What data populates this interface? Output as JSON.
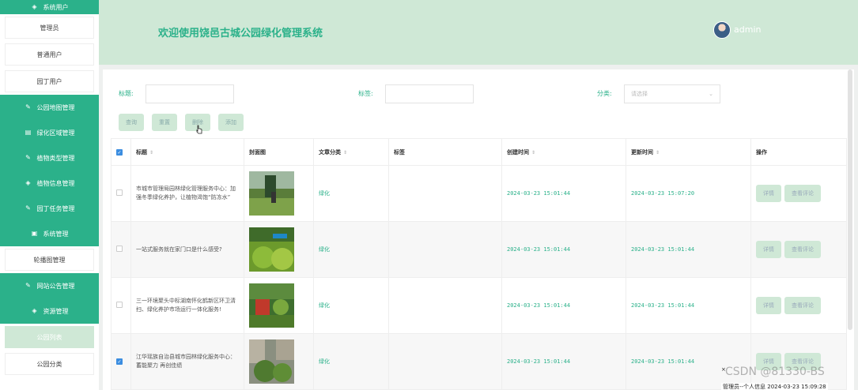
{
  "sidebar": {
    "head": "系统用户",
    "sub_users": [
      "管理员",
      "普通用户",
      "园丁用户"
    ],
    "group1": [
      "公园地图管理",
      "绿化区域管理",
      "植物类型管理",
      "植物信息管理",
      "园丁任务管理",
      "系统管理"
    ],
    "carousel": "轮播图管理",
    "group2": [
      "网站公告管理",
      "资源管理"
    ],
    "sub_res": [
      "公园列表",
      "公园分类"
    ]
  },
  "header": {
    "title": "欢迎使用饶邑古城公园绿化管理系统",
    "user": "admin"
  },
  "search": {
    "title_label": "标题:",
    "tag_label": "标签:",
    "cat_label": "分类:",
    "cat_placeholder": "请选择"
  },
  "buttons": {
    "query": "查询",
    "reset": "重置",
    "delete": "删除",
    "add": "添加"
  },
  "table": {
    "headers": {
      "title": "标题",
      "cover": "封面图",
      "category": "文章分类",
      "tags": "标签",
      "created": "创建时间",
      "updated": "更新时间",
      "ops": "操作"
    },
    "rows": [
      {
        "title": "市城市管理局园林绿化管理服务中心：加强冬季绿化养护，让植物渴饱“防冻水”",
        "category": "绿化",
        "created": "2024-03-23 15:01:44",
        "updated": "2024-03-23 15:07:20",
        "checked": false
      },
      {
        "title": "一站式服务就在家门口是什么感受?",
        "category": "绿化",
        "created": "2024-03-23 15:01:44",
        "updated": "2024-03-23 15:01:44",
        "checked": false
      },
      {
        "title": "三一环境聚头中标湖南怀化鹤新区环卫清扫、绿化养护市场运行一体化服务!",
        "category": "绿化",
        "created": "2024-03-23 15:01:44",
        "updated": "2024-03-23 15:01:44",
        "checked": false
      },
      {
        "title": "江华瑶族自治县城市园林绿化服务中心：蓄能聚力 再创佳绩",
        "category": "绿化",
        "created": "2024-03-23 15:01:44",
        "updated": "2024-03-23 15:01:44",
        "checked": true
      }
    ],
    "op_detail": "详情",
    "op_comment": "查看评论"
  },
  "overlay": {
    "watermark": "CSDN @81330-BS",
    "tooltip": "管理员--个人信息 2024-03-23 15:09:28",
    "close": "×"
  },
  "colors": {
    "primary": "#2bb18a",
    "light": "#cfe8d6"
  }
}
